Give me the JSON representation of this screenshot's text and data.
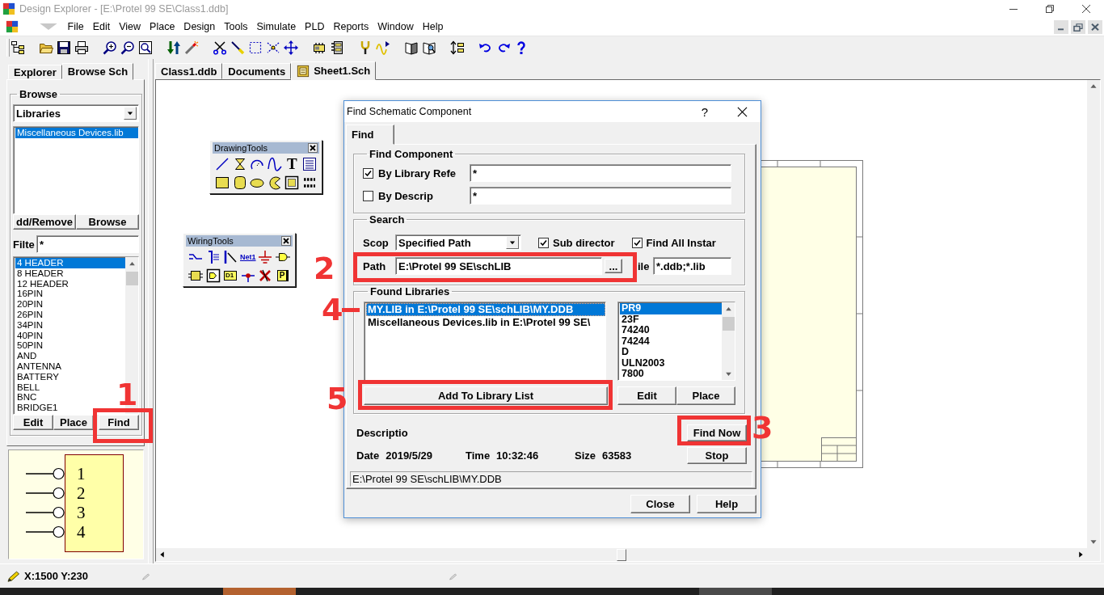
{
  "window": {
    "title": "Design Explorer - [E:\\Protel 99 SE\\Class1.ddb]",
    "active": false
  },
  "menu": [
    "File",
    "Edit",
    "View",
    "Place",
    "Design",
    "Tools",
    "Simulate",
    "PLD",
    "Reports",
    "Window",
    "Help"
  ],
  "left_panel": {
    "tabs": [
      {
        "label": "Explorer",
        "selected": false
      },
      {
        "label": "Browse Sch",
        "selected": true
      }
    ],
    "browse": {
      "title": "Browse",
      "dropdown": "Libraries",
      "libraries": [
        {
          "label": "Miscellaneous Devices.lib",
          "selected": true
        }
      ],
      "buttons": [
        "dd/Remove",
        "Browse"
      ]
    },
    "filter": {
      "label": "Filte",
      "value": "*"
    },
    "components": [
      {
        "label": "4 HEADER",
        "selected": true
      },
      {
        "label": "8 HEADER",
        "selected": false
      },
      {
        "label": "12 HEADER",
        "selected": false
      },
      {
        "label": "16PIN",
        "selected": false
      },
      {
        "label": "20PIN",
        "selected": false
      },
      {
        "label": "26PIN",
        "selected": false
      },
      {
        "label": "34PIN",
        "selected": false
      },
      {
        "label": "40PIN",
        "selected": false
      },
      {
        "label": "50PIN",
        "selected": false
      },
      {
        "label": "AND",
        "selected": false
      },
      {
        "label": "ANTENNA",
        "selected": false
      },
      {
        "label": "BATTERY",
        "selected": false
      },
      {
        "label": "BELL",
        "selected": false
      },
      {
        "label": "BNC",
        "selected": false
      },
      {
        "label": "BRIDGE1",
        "selected": false
      }
    ],
    "buttons": [
      "Edit",
      "Place",
      "Find"
    ],
    "preview": {
      "pins": [
        "1",
        "2",
        "3",
        "4"
      ]
    }
  },
  "document_tabs": [
    {
      "label": "Class1.ddb",
      "kind": "database",
      "selected": false
    },
    {
      "label": "Documents",
      "kind": "folder",
      "selected": false
    },
    {
      "label": "Sheet1.Sch",
      "kind": "schematic",
      "selected": true
    }
  ],
  "floating_toolbars": [
    {
      "title": "DrawingTools",
      "tool_texts": [
        "T"
      ]
    },
    {
      "title": "WiringTools",
      "tool_texts": [
        "Net1",
        "D1",
        "P"
      ]
    }
  ],
  "dialog": {
    "title": "Find Schematic Component",
    "help_button": "?",
    "tabs": [
      {
        "label": "Find",
        "selected": true
      }
    ],
    "find_component": {
      "title": "Find Component",
      "criteria": [
        {
          "label": "By Library Refe",
          "checked": true,
          "value": "*"
        },
        {
          "label": "By Descrip",
          "checked": false,
          "value": "*"
        }
      ]
    },
    "search": {
      "title": "Search",
      "scope_label": "Scop",
      "scope": "Specified Path",
      "options": [
        {
          "label": "Sub director",
          "checked": true
        },
        {
          "label": "Find All Instar",
          "checked": true
        }
      ],
      "path_label": "Path",
      "path": "E:\\Protel 99 SE\\schLIB",
      "browse_button": "...",
      "file_label": "ile",
      "file_mask": "*.ddb;*.lib"
    },
    "found_libraries": {
      "title": "Found Libraries",
      "libraries": [
        {
          "label": "MY.LIB in E:\\Protel 99 SE\\schLIB\\MY.DDB",
          "selected": true
        },
        {
          "label": "Miscellaneous Devices.lib in E:\\Protel 99 SE\\",
          "selected": false
        }
      ],
      "components": [
        {
          "label": "PR9",
          "selected": true
        },
        {
          "label": "23F",
          "selected": false
        },
        {
          "label": "74240",
          "selected": false
        },
        {
          "label": "74244",
          "selected": false
        },
        {
          "label": "D",
          "selected": false
        },
        {
          "label": "ULN2003",
          "selected": false
        },
        {
          "label": "7800",
          "selected": false
        }
      ],
      "add_button": "Add To Library List",
      "buttons": [
        "Edit",
        "Place"
      ]
    },
    "description_label": "Descriptio",
    "details": [
      {
        "label": "Date",
        "value": "2019/5/29"
      },
      {
        "label": "Time",
        "value": "10:32:46"
      },
      {
        "label": "Size",
        "value": "63583"
      }
    ],
    "find_now_button": "Find Now",
    "stop_button": "Stop",
    "status": "E:\\Protel 99 SE\\schLIB\\MY.DDB",
    "buttons": [
      "Close",
      "Help"
    ]
  },
  "status_bar": {
    "coordinates": "X:1500 Y:230"
  },
  "annotations": [
    {
      "number": "1",
      "kind": "box"
    },
    {
      "number": "2",
      "kind": "box"
    },
    {
      "number": "3",
      "kind": "box"
    },
    {
      "number": "4",
      "kind": "dash"
    },
    {
      "number": "5",
      "kind": "box"
    }
  ]
}
